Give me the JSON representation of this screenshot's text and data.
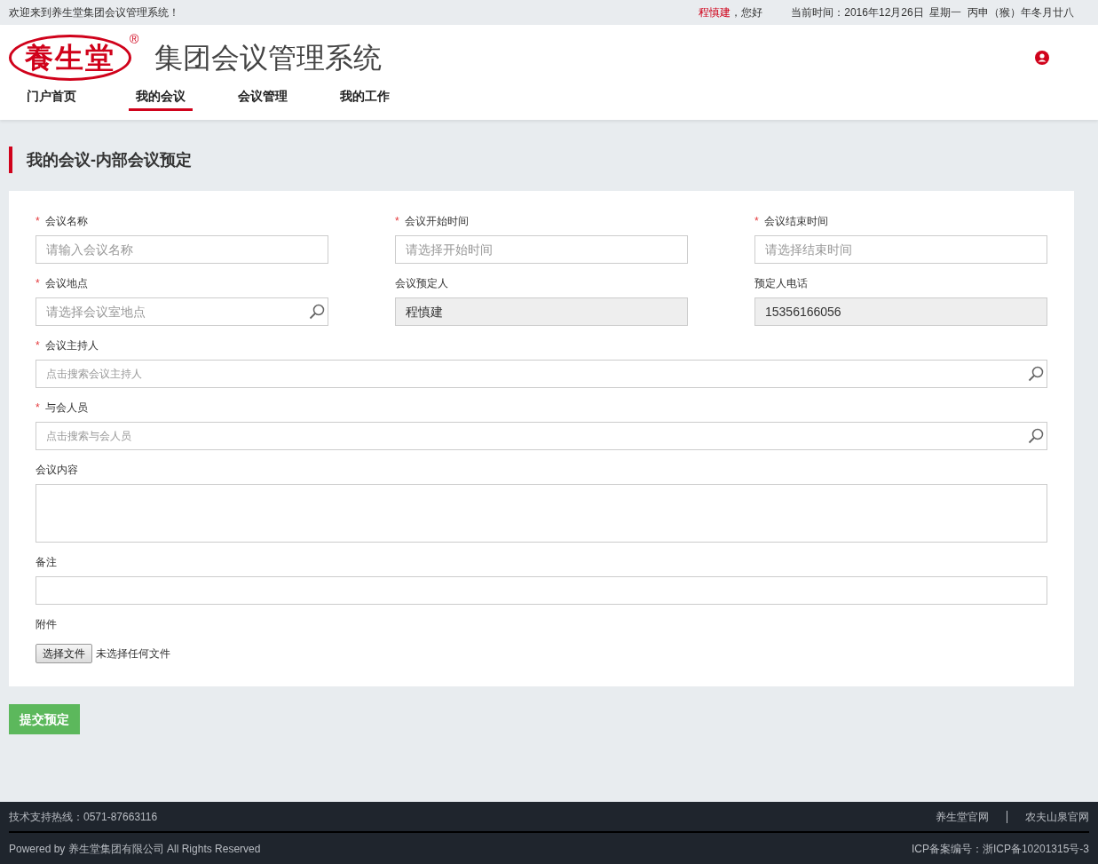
{
  "topbar": {
    "welcome": "欢迎来到养生堂集团会议管理系统！",
    "user": "程慎建",
    "greeting": "，您好",
    "datetime": "当前时间：2016年12月26日  星期一  丙申（猴）年冬月廿八"
  },
  "header": {
    "logo": {
      "text": "養生堂",
      "mark": "®"
    },
    "title": "集团会议管理系统"
  },
  "nav": [
    {
      "label": "门户首页",
      "selected": false
    },
    {
      "label": "我的会议",
      "selected": true
    },
    {
      "label": "会议管理",
      "selected": false
    },
    {
      "label": "我的工作",
      "selected": false
    }
  ],
  "page_title": "我的会议-内部会议预定",
  "form": {
    "required_mark": "*",
    "rows": [
      [
        {
          "kind": "text",
          "label": "会议名称",
          "required": true,
          "placeholder": "请输入会议名称"
        },
        {
          "kind": "text",
          "label": "会议开始时间",
          "required": true,
          "placeholder": "请选择开始时间"
        },
        {
          "kind": "text",
          "label": "会议结束时间",
          "required": true,
          "placeholder": "请选择结束时间"
        }
      ],
      [
        {
          "kind": "search",
          "label": "会议地点",
          "required": true,
          "placeholder": "请选择会议室地点"
        },
        {
          "kind": "readonly",
          "label": "会议预定人",
          "required": false,
          "value": "程慎建"
        },
        {
          "kind": "readonly",
          "label": "预定人电话",
          "required": false,
          "value": "15356166056"
        }
      ],
      [
        {
          "kind": "search",
          "label": "会议主持人",
          "required": true,
          "placeholder": "点击搜索会议主持人"
        }
      ],
      [
        {
          "kind": "search",
          "label": "与会人员",
          "required": true,
          "placeholder": "点击搜索与会人员"
        }
      ],
      [
        {
          "kind": "textarea",
          "label": "会议内容",
          "required": false
        }
      ],
      [
        {
          "kind": "text",
          "label": "备注",
          "required": false
        }
      ],
      [
        {
          "kind": "file",
          "label": "附件",
          "required": false,
          "button": "选择文件",
          "status": "未选择任何文件"
        }
      ]
    ]
  },
  "submit": "提交预定",
  "footer": {
    "hotline": "技术支持热线：0571-87663116",
    "links": [
      "养生堂官网",
      "农夫山泉官网"
    ],
    "copyright": "Powered by 养生堂集团有限公司 All Rights Reserved",
    "icp": "ICP备案编号：浙ICP备10201315号-3"
  }
}
